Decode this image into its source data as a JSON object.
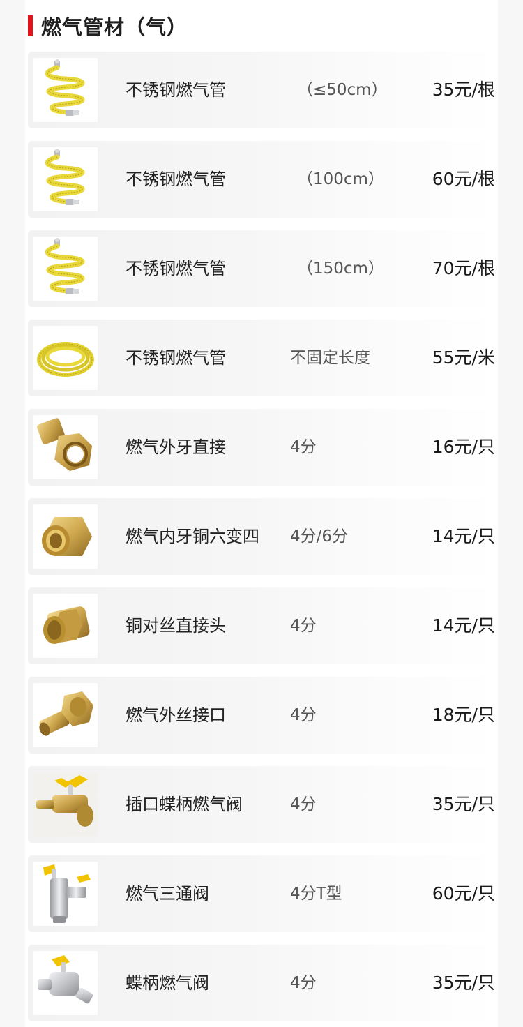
{
  "section": {
    "title": "燃气管材（气）"
  },
  "items": [
    {
      "name": "不锈钢燃气管",
      "spec": "（≤50cm）",
      "price": "35元/根",
      "icon": "yellow-coiled-gas-hose-icon"
    },
    {
      "name": "不锈钢燃气管",
      "spec": "（100cm）",
      "price": "60元/根",
      "icon": "yellow-coiled-gas-hose-icon"
    },
    {
      "name": "不锈钢燃气管",
      "spec": "（150cm）",
      "price": "70元/根",
      "icon": "yellow-coiled-gas-hose-icon"
    },
    {
      "name": "不锈钢燃气管",
      "spec": "不固定长度",
      "price": "55元/米",
      "icon": "yellow-hose-roll-icon"
    },
    {
      "name": "燃气外牙直接",
      "spec": "4分",
      "price": "16元/只",
      "icon": "brass-male-connector-icon"
    },
    {
      "name": "燃气内牙铜六变四",
      "spec": "4分/6分",
      "price": "14元/只",
      "icon": "brass-reducer-fitting-icon"
    },
    {
      "name": "铜对丝直接头",
      "spec": "4分",
      "price": "14元/只",
      "icon": "brass-nipple-fitting-icon"
    },
    {
      "name": "燃气外丝接口",
      "spec": "4分",
      "price": "18元/只",
      "icon": "brass-threaded-adapter-icon"
    },
    {
      "name": "插口蝶柄燃气阀",
      "spec": "4分",
      "price": "35元/只",
      "icon": "butterfly-handle-hose-valve-icon"
    },
    {
      "name": "燃气三通阀",
      "spec": "4分T型",
      "price": "60元/只",
      "icon": "tee-gas-valve-icon"
    },
    {
      "name": "蝶柄燃气阀",
      "spec": "4分",
      "price": "35元/只",
      "icon": "butterfly-handle-gas-valve-icon"
    }
  ],
  "colors": {
    "accent": "#e8121b",
    "hose_yellow": "#e9d83a",
    "brass": "#c9a24a"
  }
}
